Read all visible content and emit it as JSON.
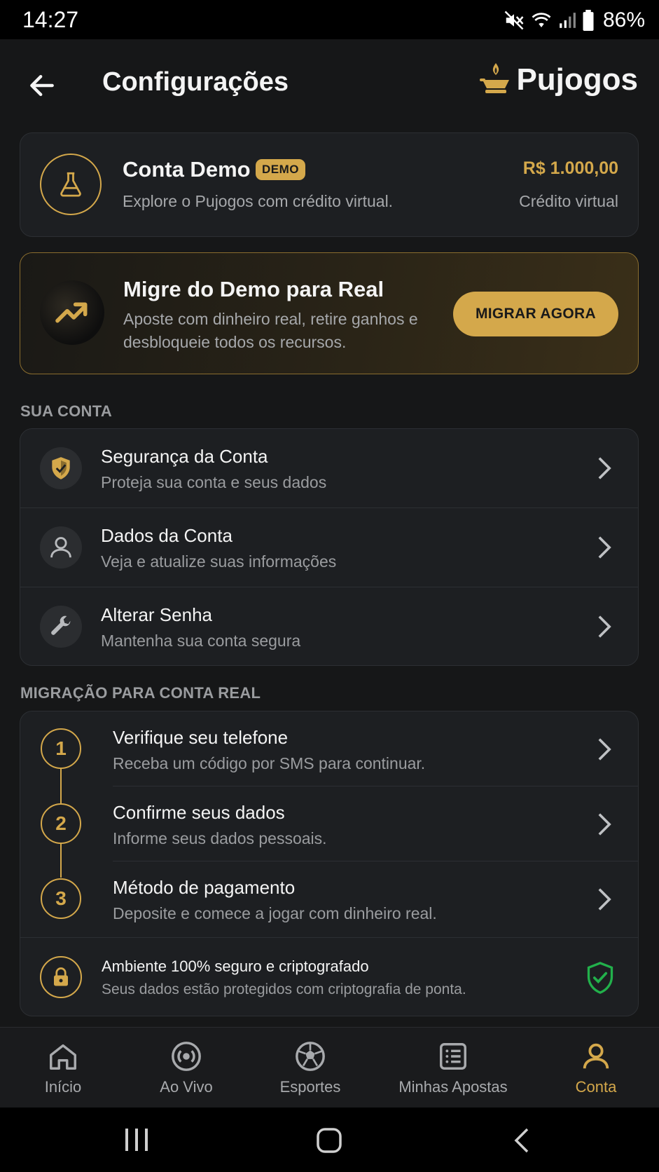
{
  "status_bar": {
    "time": "14:27",
    "battery": "86%"
  },
  "header": {
    "title": "Configurações",
    "brand": "Pujogos"
  },
  "demo_account": {
    "title": "Conta Demo",
    "badge": "DEMO",
    "subtitle": "Explore o Pujogos com crédito virtual.",
    "amount": "R$ 1.000,00",
    "amount_label": "Crédito virtual"
  },
  "migrate_banner": {
    "title": "Migre do Demo para Real",
    "description": "Aposte com dinheiro real, retire ganhos e desbloqueie todos os recursos.",
    "button": "MIGRAR AGORA"
  },
  "account_section": {
    "label": "SUA CONTA",
    "items": [
      {
        "title": "Segurança da Conta",
        "subtitle": "Proteja sua conta e seus dados",
        "icon": "shield-icon"
      },
      {
        "title": "Dados da Conta",
        "subtitle": "Veja e atualize suas informações",
        "icon": "user-icon"
      },
      {
        "title": "Alterar Senha",
        "subtitle": "Mantenha sua conta segura",
        "icon": "wrench-icon"
      }
    ]
  },
  "migration_section": {
    "label": "MIGRAÇÃO PARA CONTA REAL",
    "steps": [
      {
        "number": "1",
        "title": "Verifique seu telefone",
        "subtitle": "Receba um código por SMS para continuar."
      },
      {
        "number": "2",
        "title": "Confirme seus dados",
        "subtitle": "Informe seus dados pessoais."
      },
      {
        "number": "3",
        "title": "Método de pagamento",
        "subtitle": "Deposite e comece a jogar com dinheiro real."
      }
    ],
    "security": {
      "title": "Ambiente 100% seguro e criptografado",
      "subtitle": "Seus dados estão protegidos com criptografia de ponta."
    }
  },
  "bottom_nav": {
    "items": [
      {
        "label": "Início",
        "icon": "home-icon",
        "active": false
      },
      {
        "label": "Ao Vivo",
        "icon": "live-icon",
        "active": false
      },
      {
        "label": "Esportes",
        "icon": "soccer-ball-icon",
        "active": false
      },
      {
        "label": "Minhas Apostas",
        "icon": "bet-slip-icon",
        "active": false
      },
      {
        "label": "Conta",
        "icon": "user-icon",
        "active": true
      }
    ]
  },
  "colors": {
    "accent": "#d4a84b",
    "background": "#161718",
    "card": "#1d1f22",
    "success": "#22b04b"
  }
}
